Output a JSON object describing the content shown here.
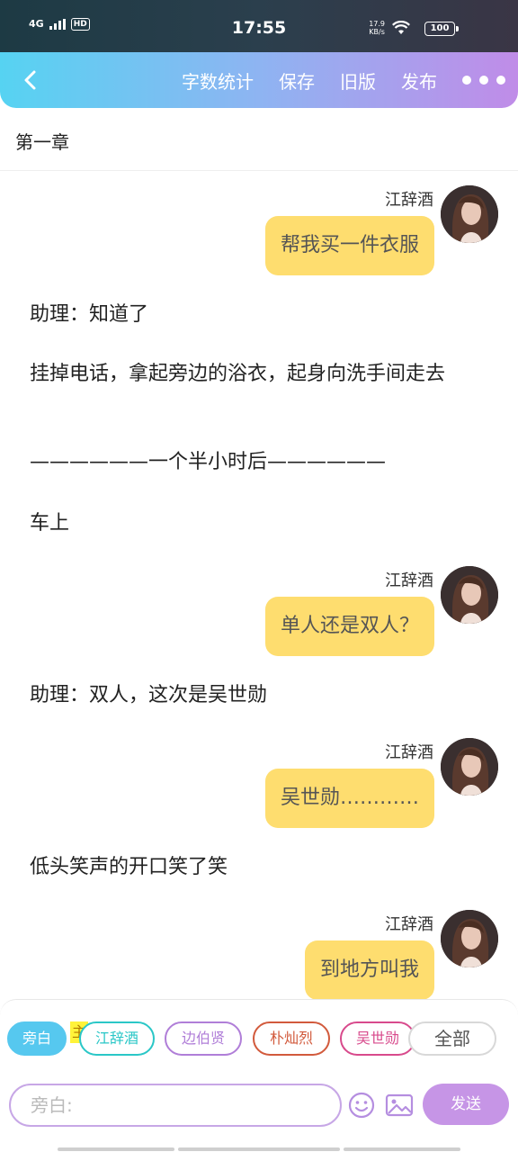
{
  "status_bar": {
    "network": "4G",
    "hd": "HD",
    "time": "17:55",
    "speed_value": "17.9",
    "speed_unit": "KB/s",
    "battery": "100"
  },
  "nav": {
    "back_icon": "chevron-left-icon",
    "actions": [
      "字数统计",
      "保存",
      "旧版",
      "发布"
    ],
    "more_icon": "more-dots-icon"
  },
  "chapter_title": "第一章",
  "story": {
    "messages": [
      {
        "speaker": "江辞酒",
        "text": "帮我买一件衣服"
      },
      {
        "speaker": "江辞酒",
        "text": "单人还是双人？"
      },
      {
        "speaker": "江辞酒",
        "text": "吴世勋…………"
      },
      {
        "speaker": "江辞酒",
        "text": "到地方叫我"
      }
    ],
    "narrations": [
      "助理：知道了",
      "挂掉电话，拿起旁边的浴衣，起身向洗手间走去",
      "——————一个半小时后——————",
      "车上",
      "助理：双人，这次是吴世勋",
      "低头笑声的开口笑了笑"
    ]
  },
  "roles": {
    "chips": [
      {
        "label": "旁白",
        "color": "#56c8ef",
        "selected": true
      },
      {
        "label": "江辞酒",
        "color": "#2ac7c7",
        "selected": false
      },
      {
        "label": "边伯贤",
        "color": "#b07ed8",
        "selected": false
      },
      {
        "label": "朴灿烈",
        "color": "#d25a3c",
        "selected": false
      },
      {
        "label": "吴世勋",
        "color": "#d84a8c",
        "selected": false
      },
      {
        "label": "全部",
        "color": "#cccccc",
        "selected": false
      }
    ],
    "main_badge": "主"
  },
  "composer": {
    "placeholder": "旁白:",
    "emoji_icon": "emoji-smile-icon",
    "image_icon": "image-icon",
    "send_label": "发送"
  }
}
